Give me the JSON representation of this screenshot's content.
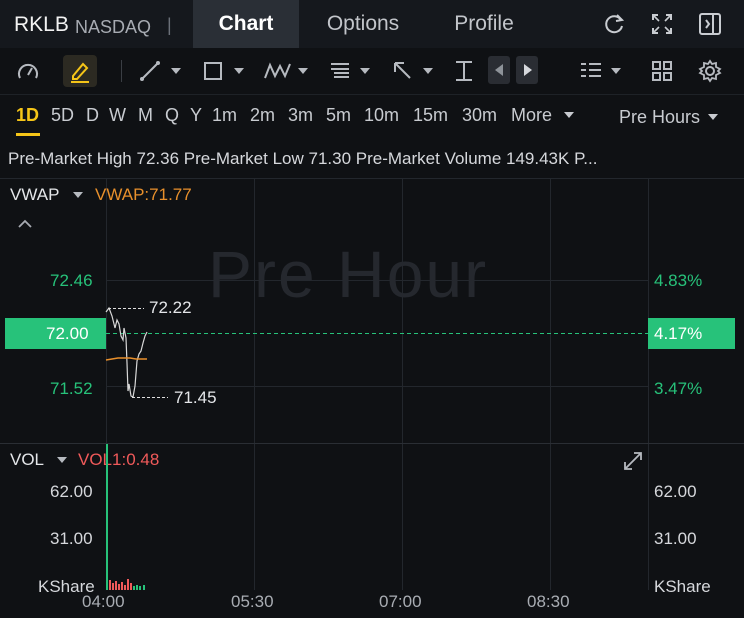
{
  "header": {
    "ticker": "RKLB",
    "exchange": "NASDAQ",
    "separator": "|",
    "tabs": [
      "Chart",
      "Options",
      "Profile"
    ]
  },
  "periods": {
    "items": [
      "1D",
      "5D",
      "D",
      "W",
      "M",
      "Q",
      "Y",
      "1m",
      "2m",
      "3m",
      "5m",
      "10m",
      "15m",
      "30m"
    ],
    "more_label": "More",
    "session_label": "Pre Hours"
  },
  "premarket": {
    "high_label": "Pre-Market High",
    "high_value": "72.36",
    "low_label": "Pre-Market Low",
    "low_value": "71.30",
    "volume_label": "Pre-Market Volume",
    "volume_value": "149.43K",
    "truncated": "P..."
  },
  "main_chart": {
    "indicator": "VWAP",
    "indicator_value": "VWAP:71.77",
    "watermark": "Pre Hour",
    "price_ticks": [
      "72.46",
      "72.00",
      "71.52"
    ],
    "percent_ticks": [
      "4.83%",
      "4.17%",
      "3.47%"
    ],
    "high_marker": "72.22",
    "low_marker": "71.45",
    "colors": {
      "up": "#27c27a",
      "vwap": "#e8902c",
      "price_line": "#d8d8d8"
    }
  },
  "volume_chart": {
    "indicator": "VOL",
    "indicator_value": "VOL1:0.48",
    "left_ticks": [
      "62.00",
      "31.00",
      "KShare"
    ],
    "right_ticks": [
      "62.00",
      "31.00",
      "KShare"
    ]
  },
  "time_axis": [
    "04:00",
    "05:30",
    "07:00",
    "08:30"
  ]
}
